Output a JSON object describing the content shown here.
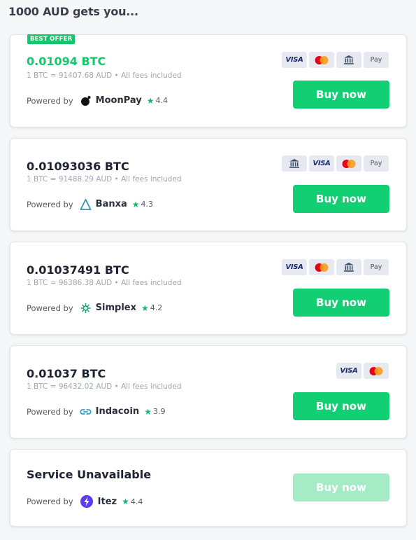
{
  "heading": "1000 AUD gets you...",
  "offers": [
    {
      "badge": "BEST OFFER",
      "amount": "0.01094 BTC",
      "rate": "1 BTC = 91407.68 AUD • All fees included",
      "powered_label": "Powered by",
      "provider": "MoonPay",
      "rating": "4.4",
      "payments": [
        "visa",
        "mastercard",
        "bank",
        "apple-pay"
      ],
      "button": "Buy now"
    },
    {
      "amount": "0.01093036 BTC",
      "rate": "1 BTC = 91488.29 AUD • All fees included",
      "powered_label": "Powered by",
      "provider": "Banxa",
      "rating": "4.3",
      "payments": [
        "bank",
        "visa",
        "mastercard",
        "apple-pay"
      ],
      "button": "Buy now"
    },
    {
      "amount": "0.01037491 BTC",
      "rate": "1 BTC = 96386.38 AUD • All fees included",
      "powered_label": "Powered by",
      "provider": "Simplex",
      "rating": "4.2",
      "payments": [
        "visa",
        "mastercard",
        "bank",
        "apple-pay"
      ],
      "button": "Buy now"
    },
    {
      "amount": "0.01037 BTC",
      "rate": "1 BTC = 96432.02 AUD • All fees included",
      "powered_label": "Powered by",
      "provider": "Indacoin",
      "rating": "3.9",
      "payments": [
        "visa",
        "mastercard"
      ],
      "button": "Buy now"
    },
    {
      "amount": "Service Unavailable",
      "powered_label": "Powered by",
      "provider": "Itez",
      "rating": "4.4",
      "button": "Buy now"
    }
  ],
  "payment_labels": {
    "visa": "VISA",
    "apple-pay": "Pay"
  },
  "colors": {
    "accent": "#13cf73",
    "best": "#13c76a",
    "disabled_button": "#a5ebc6"
  }
}
